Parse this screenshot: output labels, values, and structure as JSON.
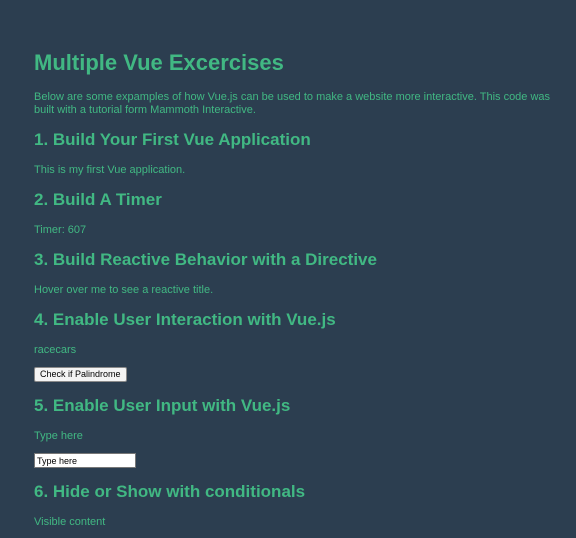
{
  "page": {
    "title": "Multiple Vue Excercises",
    "intro": "Below are some expamples of how Vue.js can be used to make a website more interactive. This code was built with a tutorial form Mammoth Interactive."
  },
  "sections": [
    {
      "heading": "1. Build Your First Vue Application",
      "text": "This is my first Vue application."
    },
    {
      "heading": "2. Build A Timer",
      "text": "Timer: 607"
    },
    {
      "heading": "3. Build Reactive Behavior with a Directive",
      "text": "Hover over me to see a reactive title."
    },
    {
      "heading": "4. Enable User Interaction with Vue.js",
      "text": "racecars",
      "button_label": "Check if Palindrome"
    },
    {
      "heading": "5. Enable User Input with Vue.js",
      "text": "Type here",
      "input_value": "Type here"
    },
    {
      "heading": "6. Hide or Show with conditionals",
      "text": "Visible content"
    }
  ],
  "colors": {
    "background": "#2c3e50",
    "text": "#41b883",
    "button_bg": "#f4f4f4",
    "input_bg": "#ffffff"
  }
}
